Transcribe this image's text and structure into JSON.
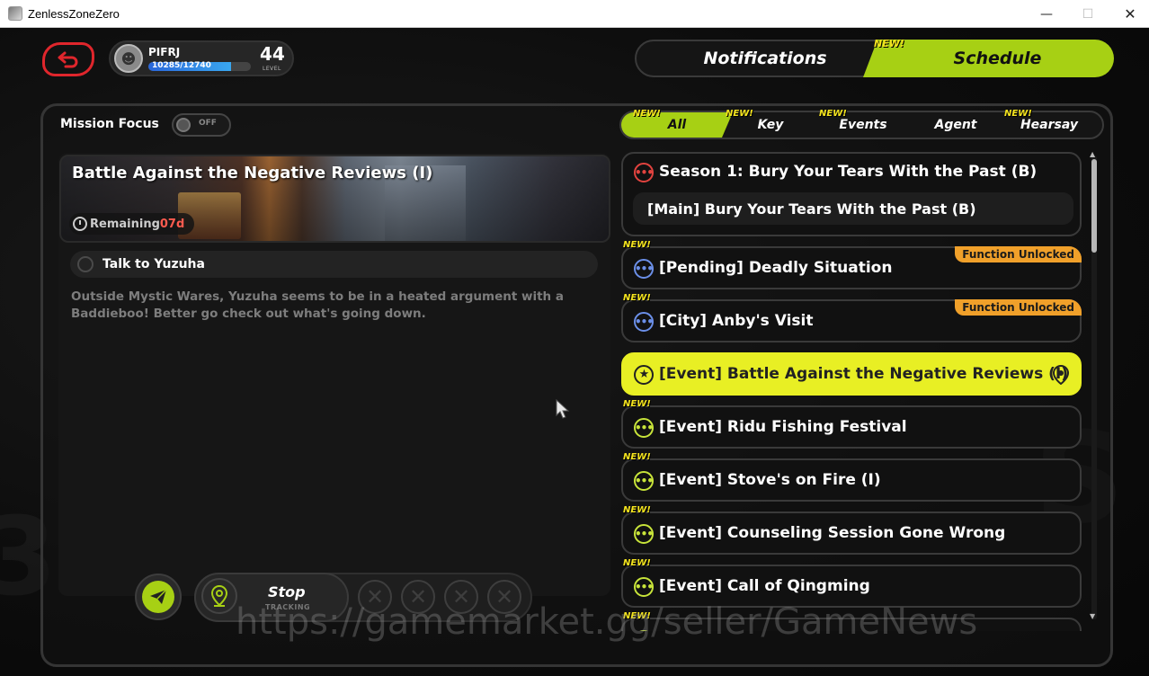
{
  "window": {
    "title": "ZenlessZoneZero",
    "min_glyph": "—",
    "max_glyph": "☐",
    "close_glyph": "✕"
  },
  "profile": {
    "name": "PIFRJ",
    "xp_text": "10285/12740",
    "xp_current": 10285,
    "xp_max": 12740,
    "level": "44",
    "level_label": "LEVEL"
  },
  "top_tabs": {
    "notifications": "Notifications",
    "schedule": "Schedule",
    "schedule_new": "NEW!"
  },
  "mission_focus": {
    "label": "Mission Focus",
    "toggle": "OFF"
  },
  "filters": [
    {
      "label": "All",
      "new": "NEW!"
    },
    {
      "label": "Key",
      "new": "NEW!"
    },
    {
      "label": "Events",
      "new": "NEW!"
    },
    {
      "label": "Agent",
      "new": ""
    },
    {
      "label": "Hearsay",
      "new": "NEW!"
    }
  ],
  "detail": {
    "title": "Battle Against the Negative Reviews (I)",
    "remaining_label": "Remaining",
    "remaining_value": "07d",
    "objective": "Talk to Yuzuha",
    "description": "Outside Mystic Wares, Yuzuha seems to be in a heated argument with a Baddieboo! Better go check out what's going down."
  },
  "tracking": {
    "stop": "Stop",
    "tracking": "TRACKING",
    "slot_glyph": "✕"
  },
  "season": {
    "title": "Season 1: Bury Your Tears With the Past (B)",
    "sub": "[Main] Bury Your Tears With the Past (B)"
  },
  "quests": [
    {
      "label": "[Pending] Deadly Situation",
      "new": "NEW!",
      "badge": "Function Unlocked",
      "color": "#6b8fe8"
    },
    {
      "label": "[City] Anby's Visit",
      "new": "NEW!",
      "badge": "Function Unlocked",
      "color": "#6b8fe8"
    },
    {
      "label": "[Event] Battle Against the Negative Reviews (I)",
      "new": "",
      "badge": "",
      "color": "#222222"
    },
    {
      "label": "[Event] Ridu Fishing Festival",
      "new": "NEW!",
      "badge": "",
      "color": "#c8e43a"
    },
    {
      "label": "[Event] Stove's on Fire (I)",
      "new": "NEW!",
      "badge": "",
      "color": "#c8e43a"
    },
    {
      "label": "[Event] Counseling Session Gone Wrong",
      "new": "NEW!",
      "badge": "",
      "color": "#c8e43a"
    },
    {
      "label": "[Event] Call of Qingming",
      "new": "NEW!",
      "badge": "",
      "color": "#c8e43a"
    },
    {
      "label": "",
      "new": "NEW!",
      "badge": "",
      "color": "#c8e43a"
    }
  ],
  "watermark": "https://gamemarket.gg/seller/GameNews",
  "colors": {
    "accent": "#a7d014",
    "highlight": "#e8ef24",
    "badge": "#f0a02a",
    "back": "#e0262c",
    "new_tag": "#f4e41e"
  }
}
